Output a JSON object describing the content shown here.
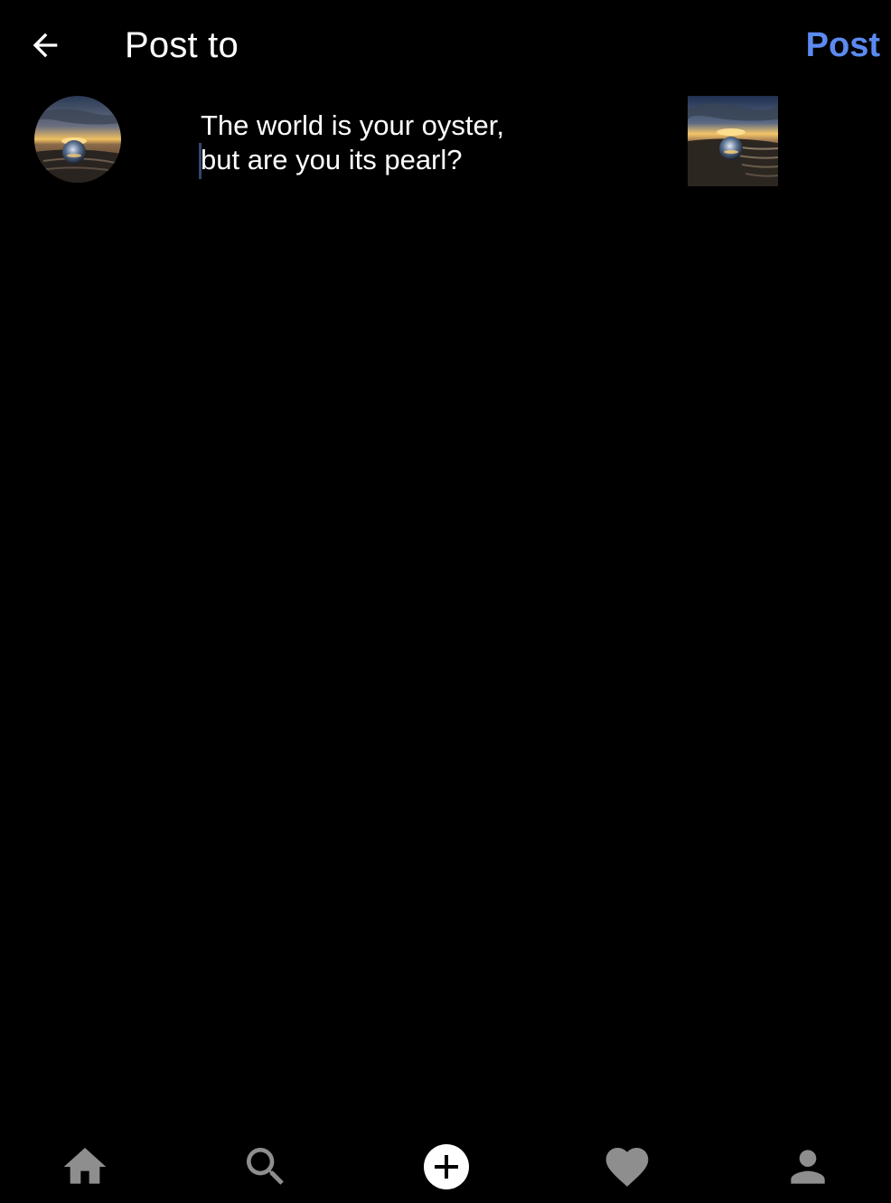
{
  "header": {
    "back_icon": "arrow-left-icon",
    "title": "Post to",
    "post_label": "Post",
    "post_color": "#5b8af0"
  },
  "compose": {
    "avatar_icon": "sunset-crystal-ball-avatar",
    "caption_lines": [
      "The world is your oyster,",
      "but are you its pearl?"
    ],
    "thumbnail_icon": "sunset-crystal-ball-photo"
  },
  "bottom_nav": {
    "items": [
      {
        "icon": "home-icon"
      },
      {
        "icon": "search-icon"
      },
      {
        "icon": "add-post-icon"
      },
      {
        "icon": "heart-icon"
      },
      {
        "icon": "profile-icon"
      }
    ],
    "icon_color": "#8e8e8e",
    "active_color": "#ffffff"
  }
}
